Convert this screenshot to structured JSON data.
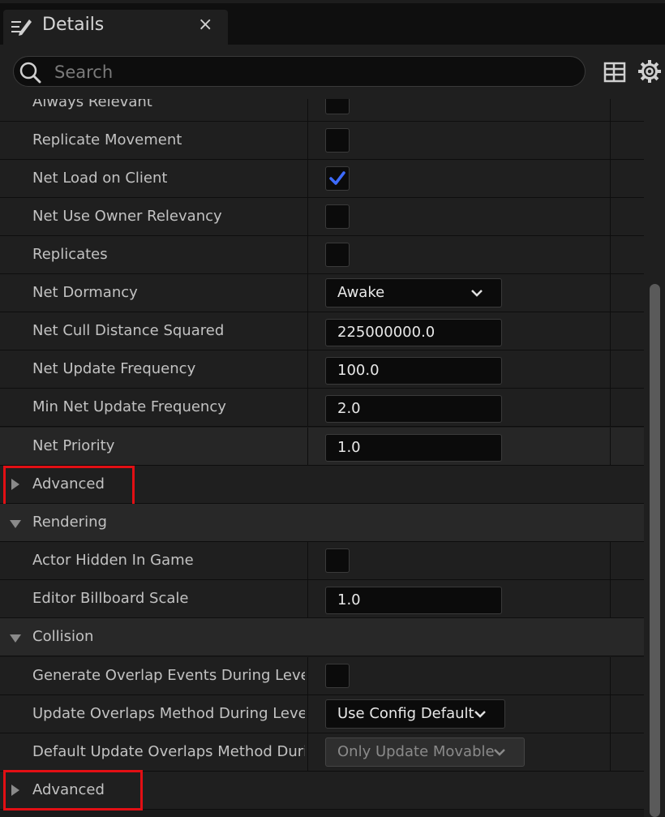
{
  "window": {
    "tab_title": "Details",
    "close_symbol": "×"
  },
  "search": {
    "placeholder": "Search"
  },
  "rows": [
    {
      "label": "Always Relevant"
    },
    {
      "label": "Replicate Movement",
      "checked": false
    },
    {
      "label": "Net Load on Client",
      "checked": true
    },
    {
      "label": "Net Use Owner Relevancy",
      "checked": false
    },
    {
      "label": "Replicates",
      "checked": false
    },
    {
      "label": "Net Dormancy",
      "value": "Awake"
    },
    {
      "label": "Net Cull Distance Squared",
      "value": "225000000.0"
    },
    {
      "label": "Net Update Frequency",
      "value": "100.0"
    },
    {
      "label": "Min Net Update Frequency",
      "value": "2.0"
    },
    {
      "label": "Net Priority",
      "value": "1.0"
    },
    {
      "label": "Advanced"
    },
    {
      "label": "Rendering"
    },
    {
      "label": "Actor Hidden In Game",
      "checked": false
    },
    {
      "label": "Editor Billboard Scale",
      "value": "1.0"
    },
    {
      "label": "Collision"
    },
    {
      "label": "Generate Overlap Events During Level…",
      "checked": false
    },
    {
      "label": "Update Overlaps Method During Leve…",
      "value": "Use Config Default"
    },
    {
      "label": "Default Update Overlaps Method Duri…",
      "value": "Only Update Movable",
      "disabled": true
    },
    {
      "label": "Advanced"
    }
  ],
  "colors": {
    "highlight": "#e20f14",
    "check": "#3d6bff",
    "panel": "#1f1f1f"
  }
}
